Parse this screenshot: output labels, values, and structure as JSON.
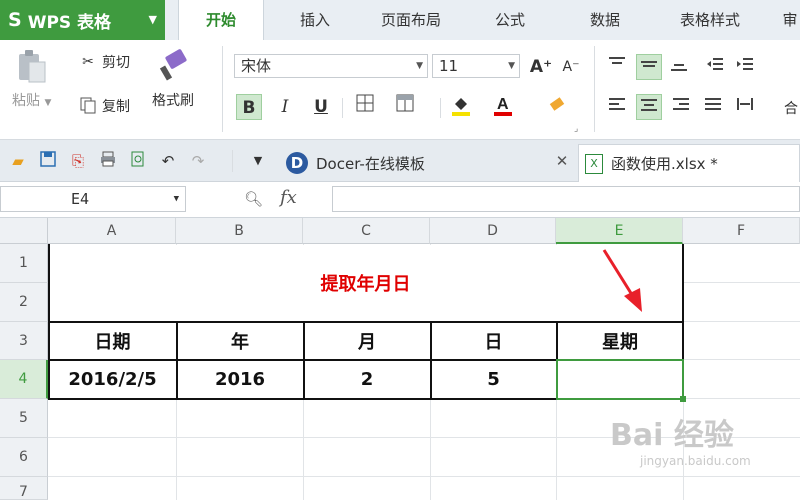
{
  "app": {
    "name": "WPS 表格",
    "logo": "wps-logo-icon"
  },
  "menu_tabs": [
    {
      "label": "开始",
      "active": true
    },
    {
      "label": "插入"
    },
    {
      "label": "页面布局"
    },
    {
      "label": "公式"
    },
    {
      "label": "数据"
    },
    {
      "label": "表格样式"
    },
    {
      "label": "审"
    }
  ],
  "ribbon": {
    "paste": "粘贴",
    "cut": "剪切",
    "copy": "复制",
    "format_painter": "格式刷",
    "font_name": "宋体",
    "font_size": "11",
    "increase_font": "A⁺",
    "decrease_font": "A⁻",
    "bold": "B",
    "italic": "I",
    "underline": "U",
    "merge_partial": "合"
  },
  "colors": {
    "accent": "#3f9b3f",
    "title_red": "#e00000",
    "highlight_yellow": "#f5e100",
    "font_red": "#e00000"
  },
  "doc_tabs": [
    {
      "label": "Docer-在线模板",
      "icon": "docer-icon"
    },
    {
      "label": "函数使用.xlsx *",
      "icon": "excel-file-icon",
      "active": true
    }
  ],
  "close_glyph": "✕",
  "formula_bar": {
    "name_box": "E4",
    "fx": "fx",
    "value": ""
  },
  "sheet": {
    "columns": [
      "A",
      "B",
      "C",
      "D",
      "E",
      "F"
    ],
    "rows": [
      "1",
      "2",
      "3",
      "4",
      "5",
      "6",
      "7"
    ],
    "selected_col": "E",
    "selected_row": "4",
    "title": "提取年月日",
    "headers": [
      "日期",
      "年",
      "月",
      "日",
      "星期"
    ],
    "values": [
      "2016/2/5",
      "2016",
      "2",
      "5",
      ""
    ]
  },
  "watermark": {
    "big": "Bai 经验",
    "small": "jingyan.baidu.com"
  }
}
